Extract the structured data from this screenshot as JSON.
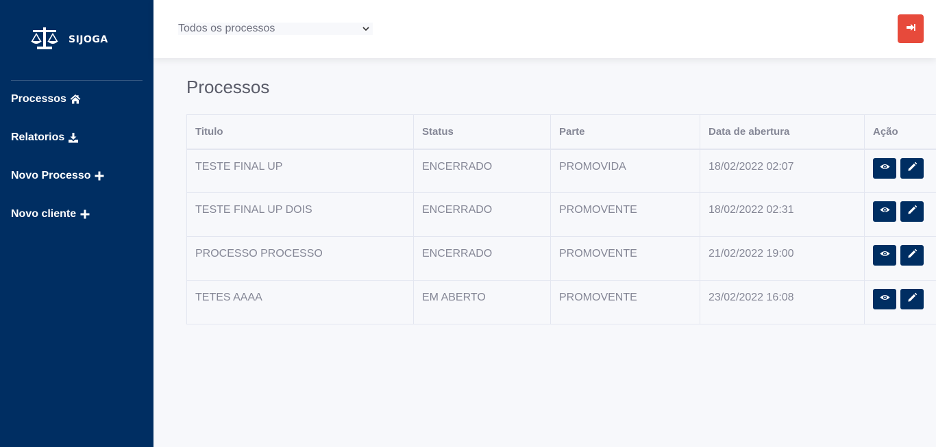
{
  "sidebar": {
    "brand_name": "SIJOGA",
    "items": [
      {
        "label": "Processos"
      },
      {
        "label": "Relatorios"
      },
      {
        "label": "Novo Processo"
      },
      {
        "label": "Novo cliente"
      }
    ]
  },
  "topbar": {
    "filter_selected": "Todos os processos"
  },
  "page": {
    "title": "Processos"
  },
  "table": {
    "headers": [
      "Titulo",
      "Status",
      "Parte",
      "Data de abertura",
      "Ação"
    ],
    "rows": [
      {
        "titulo": "TESTE FINAL UP",
        "status": "ENCERRADO",
        "parte": "PROMOVIDA",
        "data": "18/02/2022 02:07"
      },
      {
        "titulo": "TESTE FINAL UP DOIS",
        "status": "ENCERRADO",
        "parte": "PROMOVENTE",
        "data": "18/02/2022 02:31"
      },
      {
        "titulo": "PROCESSO PROCESSO",
        "status": "ENCERRADO",
        "parte": "PROMOVENTE",
        "data": "21/02/2022 19:00"
      },
      {
        "titulo": "TETES AAAA",
        "status": "EM ABERTO",
        "parte": "PROMOVENTE",
        "data": "23/02/2022 16:08"
      }
    ]
  },
  "colors": {
    "sidebar_bg": "#002e62",
    "logout_bg": "#e74a3b",
    "action_bg": "#002e62"
  }
}
